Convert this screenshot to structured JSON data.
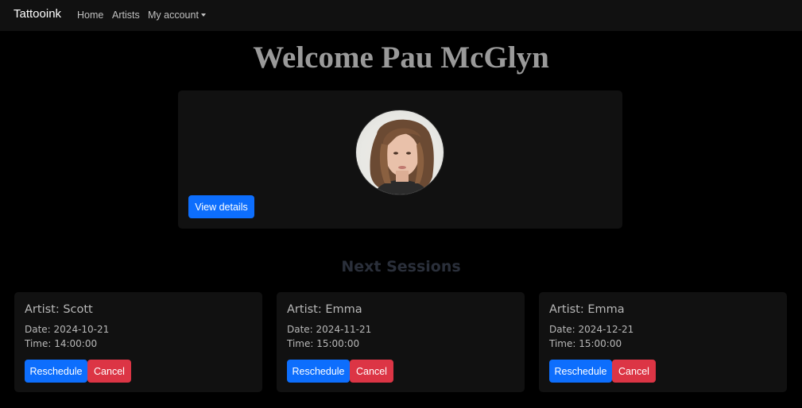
{
  "navbar": {
    "brand": "Tattooink",
    "links": [
      {
        "label": "Home"
      },
      {
        "label": "Artists"
      },
      {
        "label": "My account",
        "dropdown": true
      }
    ]
  },
  "welcome": "Welcome Pau McGlyn",
  "profile": {
    "view_details_label": "View details",
    "avatar_alt": "profile-photo"
  },
  "sessions": {
    "title": "Next Sessions",
    "items": [
      {
        "artist": "Artist: Scott",
        "date": "Date: 2024-10-21",
        "time": "Time: 14:00:00",
        "reschedule_label": "Reschedule",
        "cancel_label": "Cancel"
      },
      {
        "artist": "Artist: Emma",
        "date": "Date: 2024-11-21",
        "time": "Time: 15:00:00",
        "reschedule_label": "Reschedule",
        "cancel_label": "Cancel"
      },
      {
        "artist": "Artist: Emma",
        "date": "Date: 2024-12-21",
        "time": "Time: 15:00:00",
        "reschedule_label": "Reschedule",
        "cancel_label": "Cancel"
      }
    ]
  },
  "colors": {
    "background": "#000000",
    "navbar": "#111111",
    "card": "#111111",
    "primary": "#0d6efd",
    "danger": "#dc3545"
  }
}
